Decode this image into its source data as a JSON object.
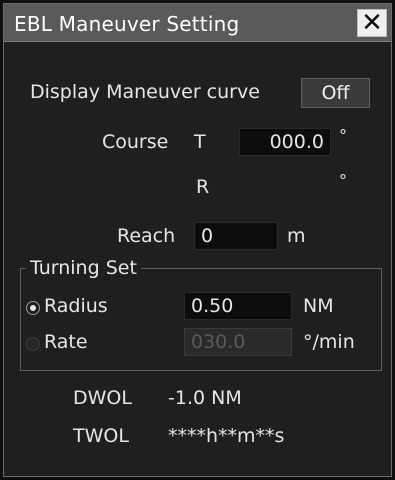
{
  "window": {
    "title": "EBL Maneuver Setting",
    "close_symbol": "✕"
  },
  "display_curve": {
    "label": "Display Maneuver curve",
    "value": "Off"
  },
  "course": {
    "label": "Course",
    "t_label": "T",
    "t_value": "000.0",
    "r_label": "R",
    "unit": "°"
  },
  "reach": {
    "label": "Reach",
    "value": "0",
    "unit": "m"
  },
  "turning_set": {
    "legend": "Turning Set",
    "radius": {
      "label": "Radius",
      "value": "0.50",
      "unit": "NM",
      "selected": true
    },
    "rate": {
      "label": "Rate",
      "value": "030.0",
      "unit": "°/min",
      "selected": false
    }
  },
  "dwol": {
    "label": "DWOL",
    "value": "-1.0 NM"
  },
  "twol": {
    "label": "TWOL",
    "value": "****h**m**s"
  }
}
